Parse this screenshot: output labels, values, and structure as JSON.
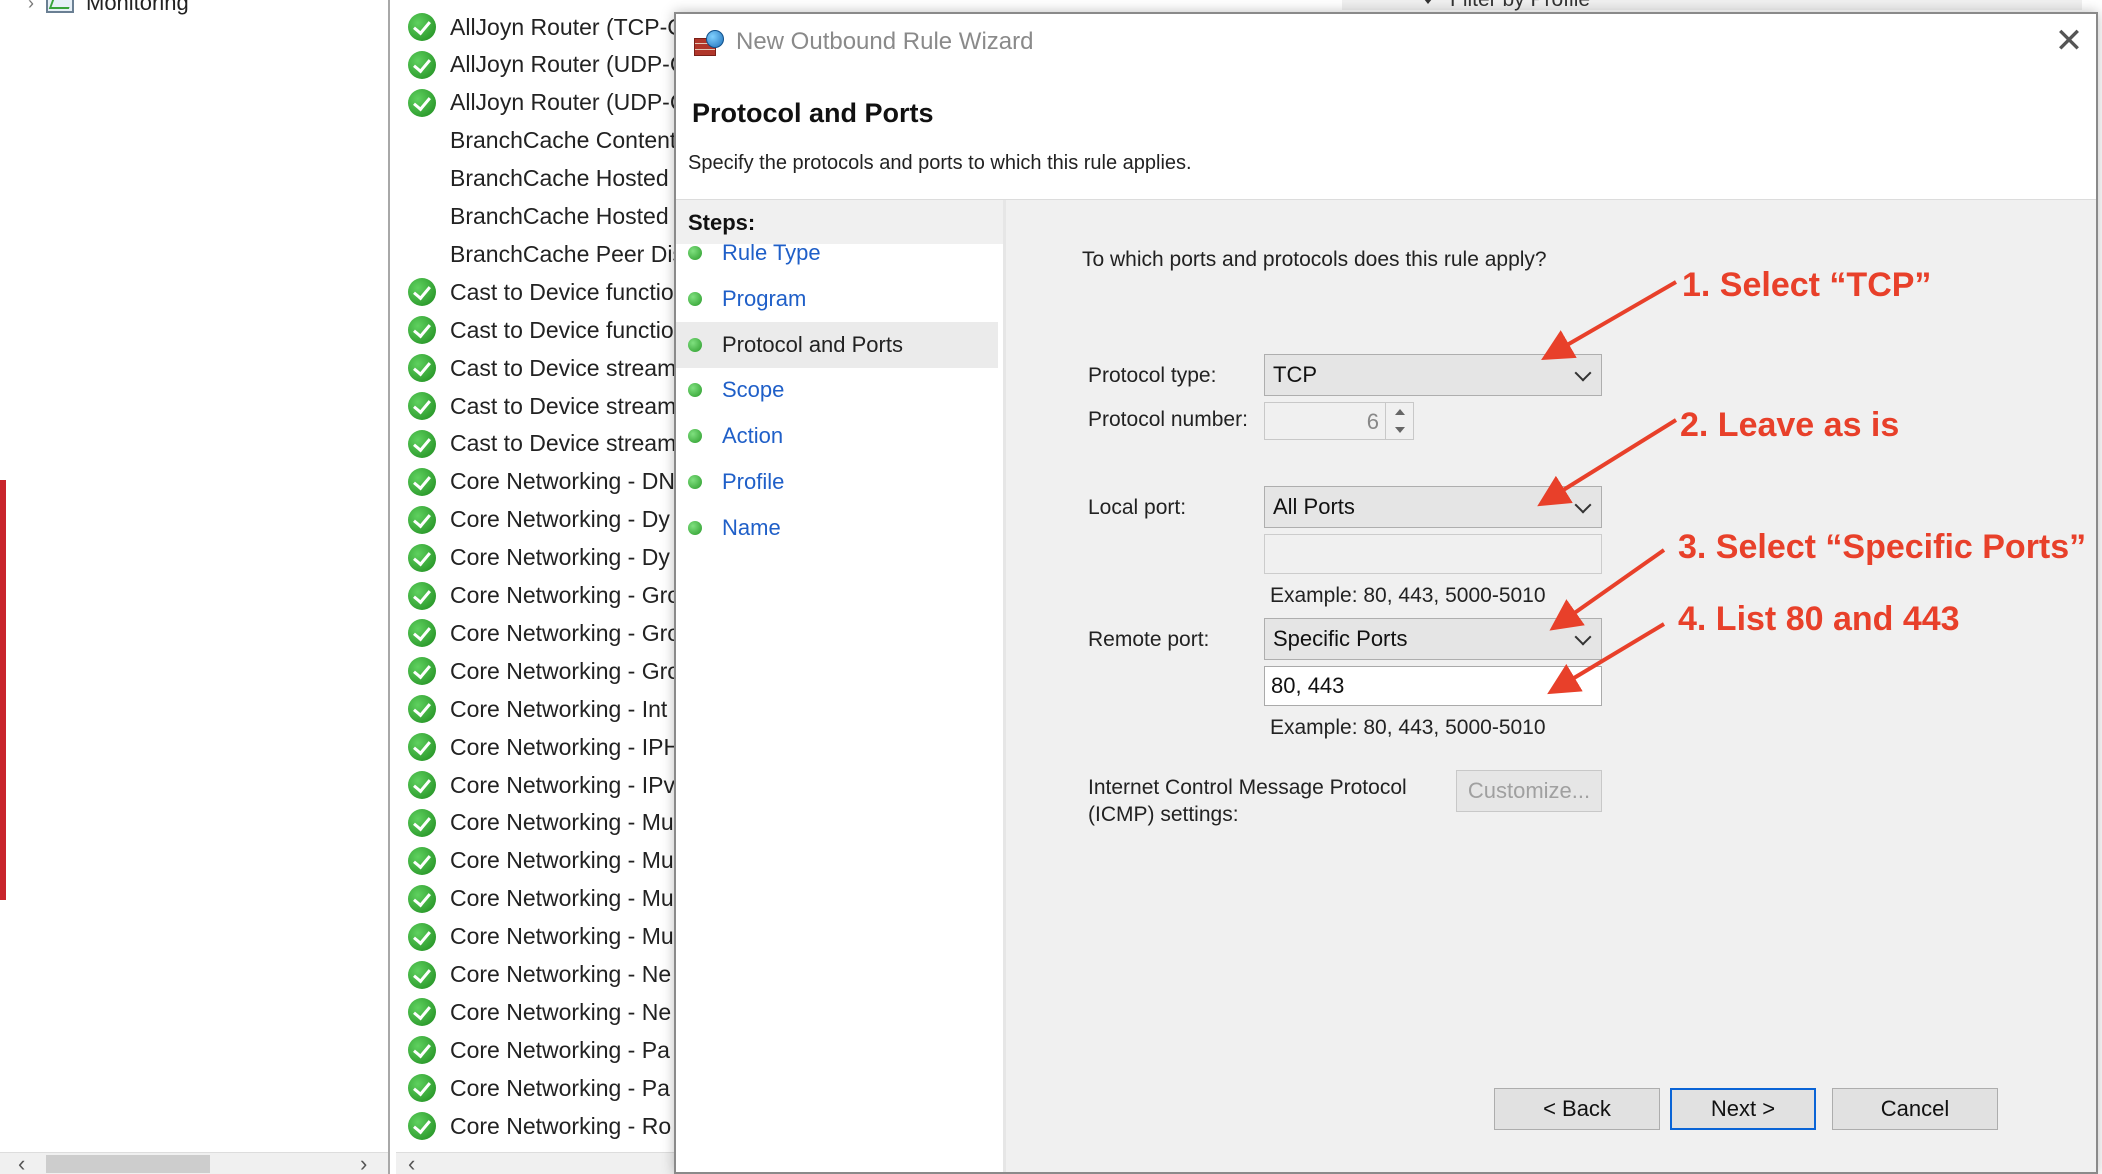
{
  "tree": {
    "monitoring_label": "Monitoring"
  },
  "rules": [
    {
      "label": "AllJoyn Router (TCP-C",
      "enabled": true
    },
    {
      "label": "AllJoyn Router (UDP-C",
      "enabled": true
    },
    {
      "label": "AllJoyn Router (UDP-C",
      "enabled": true
    },
    {
      "label": "BranchCache Content",
      "enabled": false
    },
    {
      "label": "BranchCache Hosted (",
      "enabled": false
    },
    {
      "label": "BranchCache Hosted (",
      "enabled": false
    },
    {
      "label": "BranchCache Peer Dis",
      "enabled": false
    },
    {
      "label": "Cast to Device functio",
      "enabled": true
    },
    {
      "label": "Cast to Device functio",
      "enabled": true
    },
    {
      "label": "Cast to Device streami",
      "enabled": true
    },
    {
      "label": "Cast to Device streami",
      "enabled": true
    },
    {
      "label": "Cast to Device streami",
      "enabled": true
    },
    {
      "label": "Core Networking - DN",
      "enabled": true
    },
    {
      "label": "Core Networking - Dy",
      "enabled": true
    },
    {
      "label": "Core Networking - Dy",
      "enabled": true
    },
    {
      "label": "Core Networking - Gro",
      "enabled": true
    },
    {
      "label": "Core Networking - Gro",
      "enabled": true
    },
    {
      "label": "Core Networking - Gro",
      "enabled": true
    },
    {
      "label": "Core Networking - Int",
      "enabled": true
    },
    {
      "label": "Core Networking - IPH",
      "enabled": true
    },
    {
      "label": "Core Networking - IPv",
      "enabled": true
    },
    {
      "label": "Core Networking - Mu",
      "enabled": true
    },
    {
      "label": "Core Networking - Mu",
      "enabled": true
    },
    {
      "label": "Core Networking - Mu",
      "enabled": true
    },
    {
      "label": "Core Networking - Mu",
      "enabled": true
    },
    {
      "label": "Core Networking - Ne",
      "enabled": true
    },
    {
      "label": "Core Networking - Ne",
      "enabled": true
    },
    {
      "label": "Core Networking - Pa",
      "enabled": true
    },
    {
      "label": "Core Networking - Pa",
      "enabled": true
    },
    {
      "label": "Core Networking - Ro",
      "enabled": true
    }
  ],
  "actions": {
    "filter_label": "Filter by Profile"
  },
  "dialog": {
    "title": "New Outbound Rule Wizard",
    "close_glyph": "✕",
    "page_title": "Protocol and Ports",
    "page_subtitle": "Specify the protocols and ports to which this rule applies.",
    "steps_header": "Steps:",
    "steps": [
      {
        "label": "Rule Type",
        "current": false
      },
      {
        "label": "Program",
        "current": false
      },
      {
        "label": "Protocol and Ports",
        "current": true
      },
      {
        "label": "Scope",
        "current": false
      },
      {
        "label": "Action",
        "current": false
      },
      {
        "label": "Profile",
        "current": false
      },
      {
        "label": "Name",
        "current": false
      }
    ],
    "question": "To which ports and protocols does this rule apply?",
    "protocol_type_label": "Protocol type:",
    "protocol_type_value": "TCP",
    "protocol_number_label": "Protocol number:",
    "protocol_number_value": "6",
    "local_port_label": "Local port:",
    "local_port_value": "All Ports",
    "local_port_input": "",
    "local_port_example": "Example: 80, 443, 5000-5010",
    "remote_port_label": "Remote port:",
    "remote_port_value": "Specific Ports",
    "remote_port_input": "80, 443",
    "remote_port_example": "Example: 80, 443, 5000-5010",
    "icmp_label_line1": "Internet Control Message Protocol",
    "icmp_label_line2": "(ICMP) settings:",
    "customize_button": "Customize...",
    "back_button": "< Back",
    "next_button": "Next >",
    "cancel_button": "Cancel"
  },
  "annotations": {
    "step1": "1. Select “TCP”",
    "step2": "2. Leave as is",
    "step3": "3. Select “Specific Ports”",
    "step4": "4. List 80 and 443",
    "color": "#e8402a"
  }
}
